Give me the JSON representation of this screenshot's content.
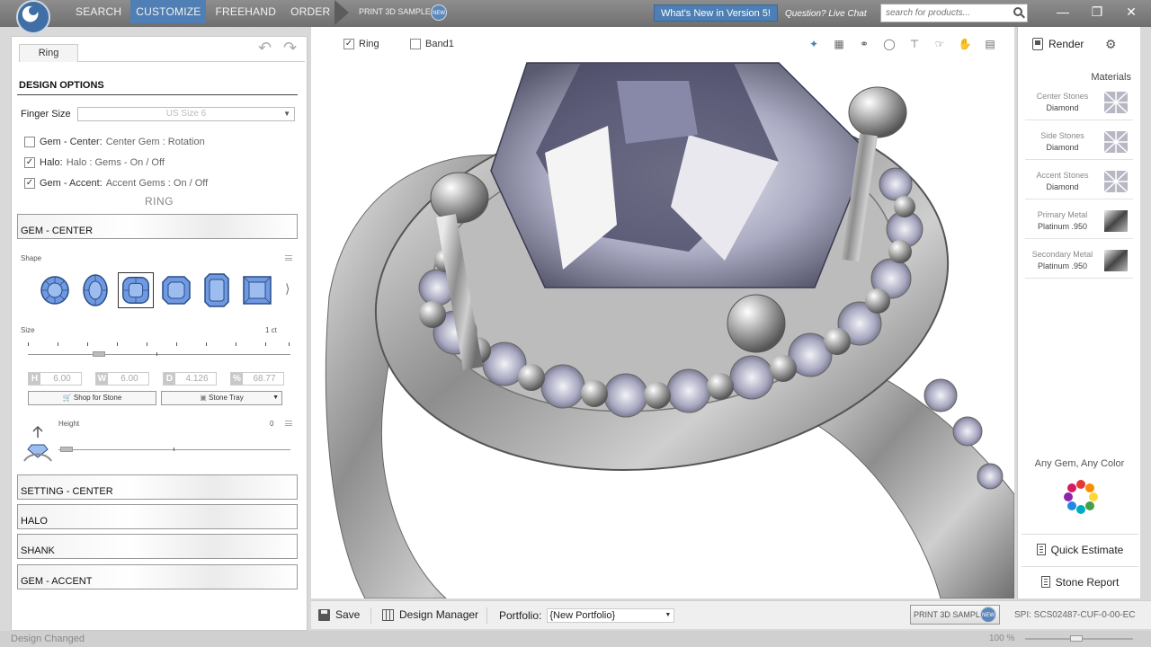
{
  "nav": {
    "items": [
      "SEARCH",
      "CUSTOMIZE",
      "FREEHAND",
      "ORDER"
    ],
    "active": "CUSTOMIZE",
    "print_sample": "PRINT 3D SAMPLE",
    "new_badge": "NEW",
    "whats_new": "What's New in Version 5!",
    "live_chat": "Question? Live Chat",
    "search_placeholder": "search for products..."
  },
  "left": {
    "tab": "Ring",
    "design_options": "DESIGN OPTIONS",
    "finger_size_label": "Finger Size",
    "finger_size_value": "US Size 6",
    "options": [
      {
        "checked": false,
        "label": "Gem - Center:",
        "value": "Center Gem : Rotation"
      },
      {
        "checked": true,
        "label": "Halo:",
        "value": "Halo : Gems - On / Off"
      },
      {
        "checked": true,
        "label": "Gem - Accent:",
        "value": "Accent Gems : On / Off"
      }
    ],
    "ring_heading": "RING",
    "gem_center": "GEM - CENTER",
    "shape_label": "Shape",
    "size_label": "Size",
    "size_value": "1 ct",
    "dims": [
      {
        "letter": "H",
        "value": "6.00"
      },
      {
        "letter": "W",
        "value": "6.00"
      },
      {
        "letter": "D",
        "value": "4.126"
      },
      {
        "letter": "%",
        "value": "68.77"
      }
    ],
    "shop_for_stone": "Shop for Stone",
    "stone_tray": "Stone Tray",
    "height_label": "Height",
    "height_value": "0",
    "sections": [
      "SETTING - CENTER",
      "HALO",
      "SHANK",
      "GEM - ACCENT"
    ]
  },
  "viewport": {
    "ring_label": "Ring",
    "ring_checked": true,
    "band_label": "Band1",
    "band_checked": false
  },
  "right": {
    "render": "Render",
    "materials": "Materials",
    "items": [
      {
        "name": "Center Stones",
        "value": "Diamond"
      },
      {
        "name": "Side Stones",
        "value": "Diamond"
      },
      {
        "name": "Accent Stones",
        "value": "Diamond"
      },
      {
        "name": "Primary Metal",
        "value": "Platinum .950"
      },
      {
        "name": "Secondary Metal",
        "value": "Platinum .950"
      }
    ],
    "any_gem": "Any Gem, Any Color",
    "quick_estimate": "Quick Estimate",
    "stone_report": "Stone Report"
  },
  "bottom": {
    "save": "Save",
    "design_manager": "Design Manager",
    "portfolio_label": "Portfolio:",
    "portfolio_value": "{New Portfolio}",
    "print_sample": "PRINT 3D SAMPLE",
    "spi": "SPI:   SCS02487-CUF-0-00-EC"
  },
  "status": {
    "text": "Design Changed",
    "zoom": "100 %"
  },
  "colors": {
    "accent": "#4f7fb4",
    "gem_blue": "#6f99e0",
    "metal": "#9a9a9a"
  }
}
